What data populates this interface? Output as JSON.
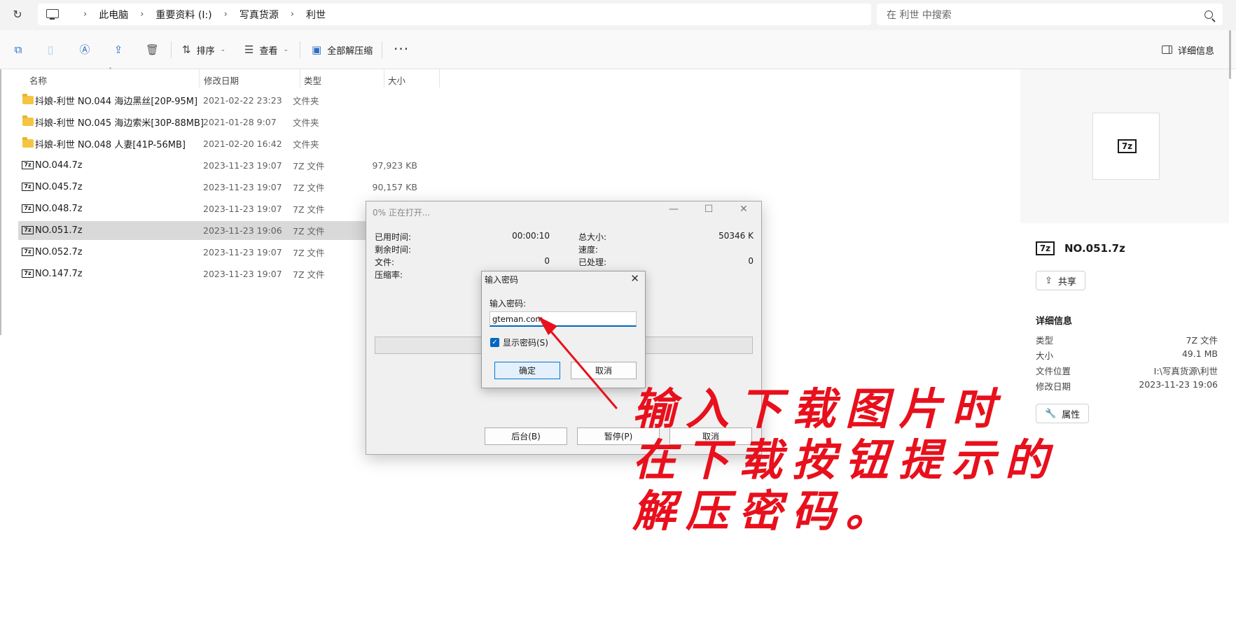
{
  "address": {
    "breadcrumbs": [
      "此电脑",
      "重要资料 (I:)",
      "写真货源",
      "利世"
    ],
    "search_placeholder": "在 利世 中搜索"
  },
  "toolbar": {
    "sort_label": "排序",
    "view_label": "查看",
    "extract_all_label": "全部解压缩",
    "more_label": "···",
    "details_label": "详细信息"
  },
  "list": {
    "columns": [
      "名称",
      "修改日期",
      "类型",
      "大小"
    ],
    "rows": [
      {
        "name": "抖娘-利世 NO.044 海边黑丝[20P-95M]",
        "date": "2021-02-22 23:23",
        "type": "文件夹",
        "size": "",
        "kind": "folder"
      },
      {
        "name": "抖娘-利世 NO.045 海边索米[30P-88MB]",
        "date": "2021-01-28 9:07",
        "type": "文件夹",
        "size": "",
        "kind": "folder"
      },
      {
        "name": "抖娘-利世 NO.048 人妻[41P-56MB]",
        "date": "2021-02-20 16:42",
        "type": "文件夹",
        "size": "",
        "kind": "folder"
      },
      {
        "name": "NO.044.7z",
        "date": "2023-11-23 19:07",
        "type": "7Z 文件",
        "size": "97,923 KB",
        "kind": "7z"
      },
      {
        "name": "NO.045.7z",
        "date": "2023-11-23 19:07",
        "type": "7Z 文件",
        "size": "90,157 KB",
        "kind": "7z"
      },
      {
        "name": "NO.048.7z",
        "date": "2023-11-23 19:07",
        "type": "7Z 文件",
        "size": "",
        "kind": "7z"
      },
      {
        "name": "NO.051.7z",
        "date": "2023-11-23 19:06",
        "type": "7Z 文件",
        "size": "",
        "kind": "7z",
        "selected": true
      },
      {
        "name": "NO.052.7z",
        "date": "2023-11-23 19:07",
        "type": "7Z 文件",
        "size": "",
        "kind": "7z"
      },
      {
        "name": "NO.147.7z",
        "date": "2023-11-23 19:07",
        "type": "7Z 文件",
        "size": "",
        "kind": "7z"
      }
    ]
  },
  "details": {
    "icon_text": "7z",
    "filename": "NO.051.7z",
    "share_label": "共享",
    "section_title": "详细信息",
    "fields": [
      {
        "key": "类型",
        "value": "7Z 文件"
      },
      {
        "key": "大小",
        "value": "49.1 MB"
      },
      {
        "key": "文件位置",
        "value": "I:\\写真货源\\利世"
      },
      {
        "key": "修改日期",
        "value": "2023-11-23 19:06"
      }
    ],
    "properties_label": "属性"
  },
  "progress_dialog": {
    "title": "0% 正在打开...",
    "elapsed_label": "已用时间:",
    "elapsed_value": "00:00:10",
    "remaining_label": "剩余时间:",
    "files_label": "文件:",
    "files_value": "0",
    "ratio_label": "压缩率:",
    "total_label": "总大小:",
    "total_value": "50346 K",
    "speed_label": "速度:",
    "processed_label": "已处理:",
    "processed_value": "0",
    "background_label": "后台(B)",
    "pause_label": "暂停(P)",
    "cancel_label": "取消"
  },
  "password_dialog": {
    "title": "输入密码",
    "prompt": "输入密码:",
    "value": "gteman.com",
    "show_password_label": "显示密码(S)",
    "show_password_checked": true,
    "ok_label": "确定",
    "cancel_label": "取消"
  },
  "annotation": {
    "lines": [
      "输入下载图片时",
      "在下载按钮提示的",
      "解压密码。"
    ],
    "color": "#e8101c"
  }
}
